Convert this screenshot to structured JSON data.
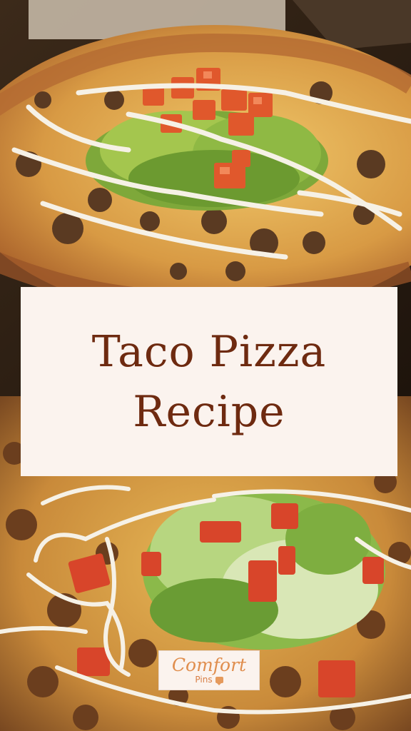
{
  "pin": {
    "title_line1": "Taco Pizza",
    "title_line2": "Recipe"
  },
  "brand": {
    "name": "Comfort",
    "suffix": "Pins"
  },
  "images": {
    "top_photo": "taco pizza with lettuce, diced tomatoes and sour cream drizzle",
    "bottom_photo": "close-up of taco pizza with shredded lettuce and tomatoes"
  },
  "colors": {
    "title_text": "#6e2a10",
    "card_background": "#fbf3ee",
    "logo_accent": "#e08e4e"
  }
}
